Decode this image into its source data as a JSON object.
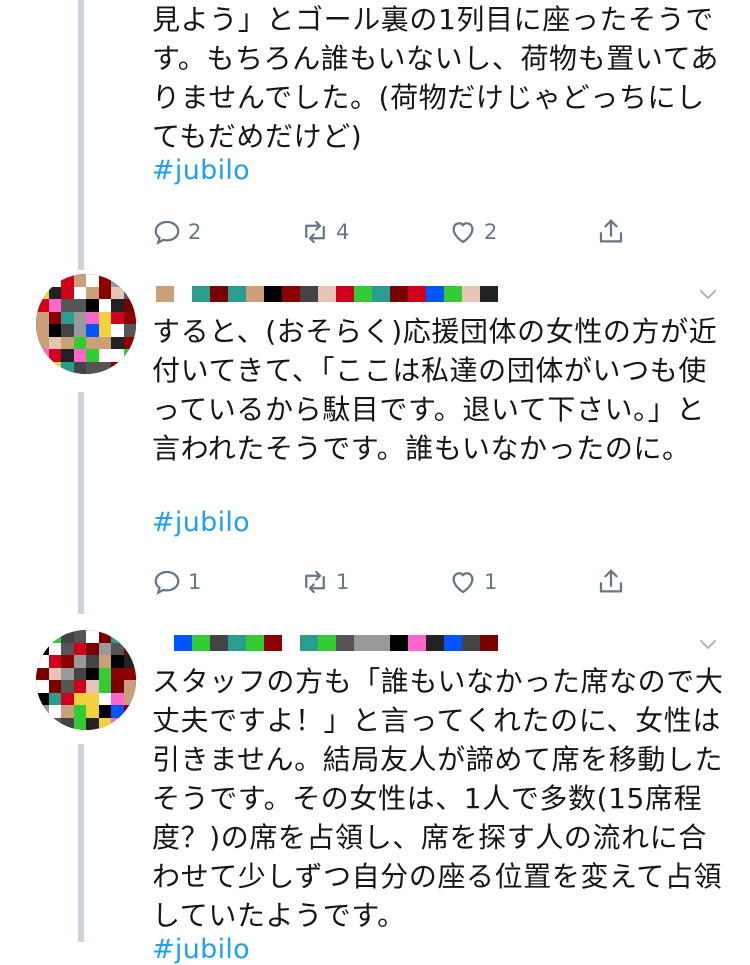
{
  "tweets": [
    {
      "text": "見よう」とゴール裏の1列目に座ったそうです。もちろん誰もいないし、荷物も置いてありませんでした。(荷物だけじゃどっちにしてもだめだけど)",
      "hashtag": "#jubilo",
      "reply_count": "2",
      "retweet_count": "4",
      "like_count": "2"
    },
    {
      "text": "すると、(おそらく)応援団体の女性の方が近付いてきて、「ここは私達の団体がいつも使っているから駄目です。退いて下さい。」と言われたそうです。誰もいなかったのに。",
      "hashtag": "#jubilo",
      "reply_count": "1",
      "retweet_count": "1",
      "like_count": "1"
    },
    {
      "text": "スタッフの方も「誰もいなかった席なので大丈夫ですよ！」と言ってくれたのに、女性は引きません。結局友人が諦めて席を移動したそうです。その女性は、1人で多数(15席程度？)の席を占領し、席を探す人の流れに合わせて少しずつ自分の座る位置を変えて占領していたようです。",
      "hashtag": "#jubilo"
    }
  ],
  "icons": {
    "reply": "reply-icon",
    "retweet": "retweet-icon",
    "like": "heart-icon",
    "share": "share-icon",
    "more": "chevron-down-icon"
  },
  "colors": {
    "link": "#1da1f2",
    "muted": "#657786",
    "thread_line": "#ccd6dd",
    "text": "#14171a"
  }
}
